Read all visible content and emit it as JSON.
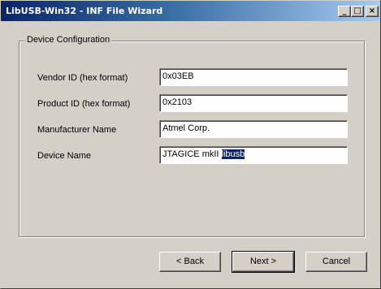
{
  "window": {
    "title": "LibUSB-Win32 - INF File Wizard",
    "minimize_glyph": "_",
    "maximize_glyph": "□",
    "close_glyph": "×"
  },
  "group": {
    "title": "Device Configuration"
  },
  "fields": [
    {
      "label": "Vendor ID (hex format)",
      "value": "0x03EB"
    },
    {
      "label": "Product ID (hex format)",
      "value": "0x2103"
    },
    {
      "label": "Manufacturer Name",
      "value": "Atmel Corp."
    },
    {
      "label": "Device Name",
      "value": "JTAGICE mkII ",
      "selected_text": "libusb"
    }
  ],
  "buttons": {
    "back": "< Back",
    "next": "Next >",
    "cancel": "Cancel"
  },
  "colors": {
    "titlebar_start": "#0a246a",
    "titlebar_end": "#a6caf0",
    "face": "#d4d0c8",
    "selection": "#0a246a"
  }
}
